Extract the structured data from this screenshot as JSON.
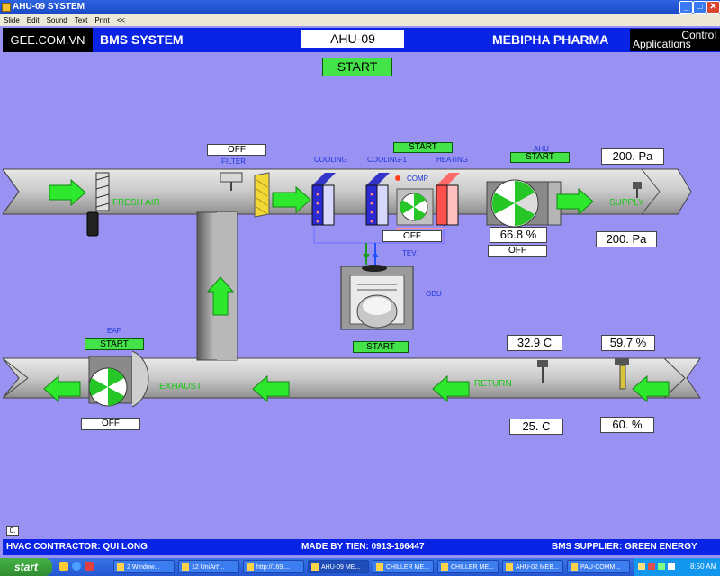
{
  "window": {
    "title": "AHU-09 SYSTEM",
    "min": "_",
    "max": "□",
    "close": "✕"
  },
  "menu": {
    "items": [
      "Slide",
      "Edit",
      "Sound",
      "Text",
      "Print",
      "<<"
    ]
  },
  "header": {
    "company": "GEE.COM.VN",
    "system": "BMS SYSTEM",
    "unit": "AHU-09",
    "client": "MEBIPHA PHARMA",
    "control_1": "Control",
    "control_2": "Applications"
  },
  "main": {
    "start_button": "START",
    "filter": {
      "status": "OFF",
      "label": "FILTER"
    },
    "cooling": {
      "label": "COOLING"
    },
    "cooling1": {
      "label": "COOLING-1"
    },
    "comp": {
      "label": "COMP",
      "button": "START",
      "status": "OFF"
    },
    "heating": {
      "label": "HEATING"
    },
    "tev": {
      "label": "TEV"
    },
    "ahu": {
      "label": "AHU",
      "button": "START",
      "speed": "66.8 %",
      "status": "OFF"
    },
    "odu": {
      "label": "ODU",
      "button": "START"
    },
    "fresh_air": {
      "label": "FRESH AIR"
    },
    "supply": {
      "label": "SUPPLY",
      "pressure_top": "200. Pa",
      "pressure_bottom": "200. Pa"
    },
    "eaf": {
      "label": "EAF",
      "button": "START",
      "status": "OFF"
    },
    "exhaust": {
      "label": "EXHAUST"
    },
    "return": {
      "label": "RETURN",
      "temp": "32.9 C",
      "humidity": "59.7 %",
      "temp_set": "25. C",
      "humidity_set": "60. %"
    },
    "corner": "0."
  },
  "footer": {
    "contractor": "HVAC CONTRACTOR: QUI LONG",
    "made_by": "MADE BY TIEN: 0913-166447",
    "supplier": "BMS SUPPLIER: GREEN ENERGY"
  },
  "taskbar": {
    "start": "start",
    "tasks": [
      "2 Window...",
      "12 UniArt'...",
      "http://169....",
      "AHU-09 ME...",
      "CHILLER ME...",
      "CHILLER ME...",
      "AHU-02 MEB...",
      "PAU-COMM..."
    ],
    "clock": "8:50 AM"
  },
  "colors": {
    "header": "#0a24e6",
    "background": "#9a92f2",
    "button_green": "#44e34a",
    "arrow_green": "#2ee82e"
  }
}
